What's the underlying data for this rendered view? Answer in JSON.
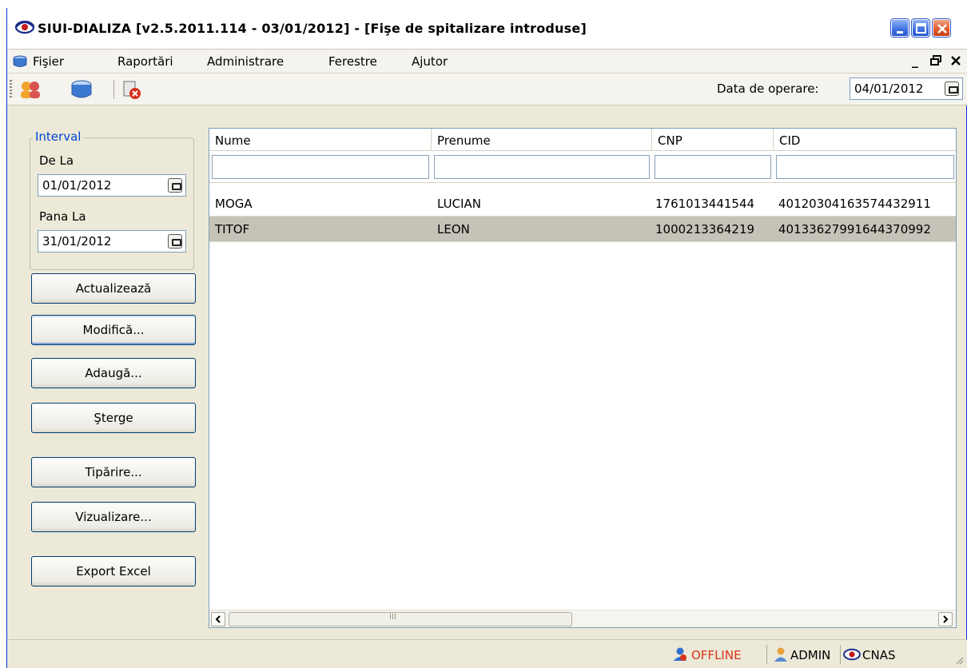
{
  "window": {
    "title": "SIUI-DIALIZA [v2.5.2011.114 - 03/01/2012] - [Fişe de spitalizare introduse]"
  },
  "menu": {
    "items": [
      "Fişier",
      "Raportări",
      "Administrare",
      "Ferestre",
      "Ajutor"
    ]
  },
  "toolbar": {
    "operation_date_label": "Data de operare:",
    "operation_date_value": "04/01/2012"
  },
  "interval": {
    "legend": "Interval",
    "from_label": "De La",
    "from_value": "01/01/2012",
    "to_label": "Pana La",
    "to_value": "31/01/2012"
  },
  "buttons": {
    "refresh": "Actualizează",
    "modify": "Modifică...",
    "add": "Adaugă...",
    "delete": "Şterge",
    "print": "Tipărire...",
    "preview": "Vizualizare...",
    "export": "Export Excel"
  },
  "grid": {
    "columns": [
      "Nume",
      "Prenume",
      "CNP",
      "CID"
    ],
    "rows": [
      {
        "nume": "MOGA",
        "prenume": "LUCIAN",
        "cnp": "1761013441544",
        "cid": "40120304163574432911"
      },
      {
        "nume": "TITOF",
        "prenume": "LEON",
        "cnp": "1000213364219",
        "cid": "40133627991644370992"
      }
    ],
    "selected_row": 1,
    "scroll_thumb_glyph": "III"
  },
  "status": {
    "connection": "OFFLINE",
    "user": "ADMIN",
    "org": "CNAS"
  },
  "colors": {
    "offline": "#d9341a",
    "group_legend": "#0046d5",
    "selection": "#c5c2b8"
  }
}
